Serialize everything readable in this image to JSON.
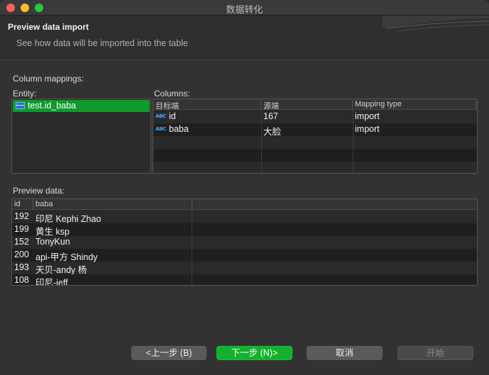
{
  "window": {
    "title": "数据转化"
  },
  "header": {
    "title": "Preview data import",
    "description": "See how data will be imported into the table"
  },
  "mappings": {
    "section_label": "Column mappings:",
    "entity_label": "Entity:",
    "columns_label": "Columns:",
    "entity": "test.id_baba",
    "column_headers": [
      "目标端",
      "源端",
      "Mapping type"
    ],
    "rows": [
      {
        "target": "id",
        "source": "167",
        "type": "import"
      },
      {
        "target": "baba",
        "source": "大脸",
        "type": "import"
      }
    ],
    "type_icon": "abc-text-icon",
    "type_icon_text": "ABC"
  },
  "preview": {
    "label": "Preview data:",
    "headers": [
      "id",
      "baba"
    ],
    "rows": [
      {
        "id": "192",
        "baba": "印尼 Kephi Zhao"
      },
      {
        "id": "199",
        "baba": "黄生 ksp"
      },
      {
        "id": "152",
        "baba": "TonyKun"
      },
      {
        "id": "200",
        "baba": "api-甲方 Shindy"
      },
      {
        "id": "193",
        "baba": "天贝-andy 杨"
      },
      {
        "id": "108",
        "baba": "印尼-jeff"
      }
    ]
  },
  "footer": {
    "back": "<上一步 (B)",
    "next": "下一步 (N)>",
    "cancel": "取消",
    "start": "开始"
  },
  "colors": {
    "accent": "#13b12e",
    "selection": "#0f9a2c",
    "icon_blue": "#4aa3ff"
  }
}
